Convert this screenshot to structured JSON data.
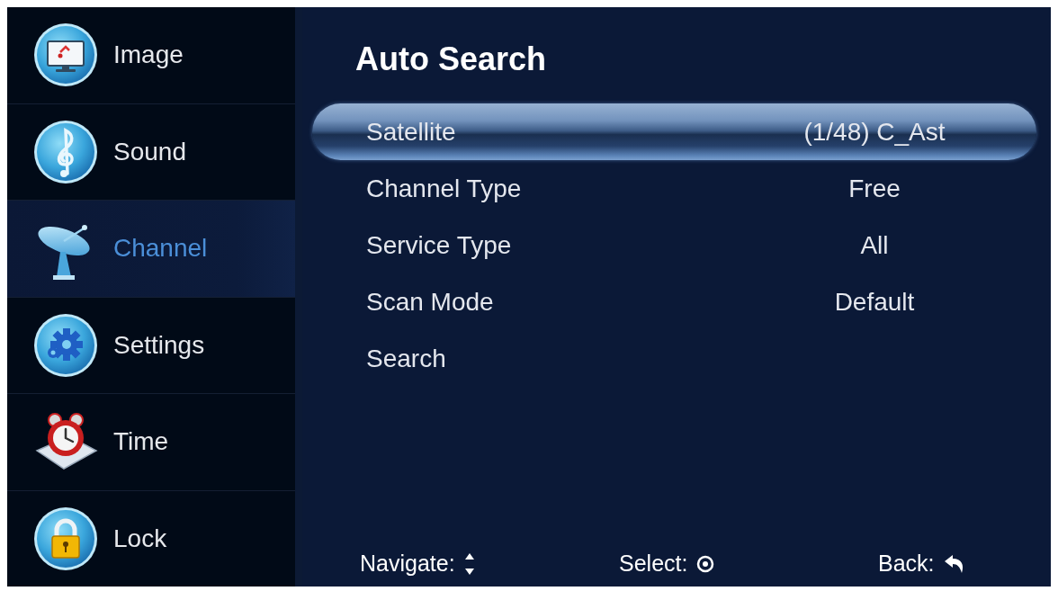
{
  "sidebar": {
    "items": [
      {
        "label": "Image",
        "selected": false
      },
      {
        "label": "Sound",
        "selected": false
      },
      {
        "label": "Channel",
        "selected": true
      },
      {
        "label": "Settings",
        "selected": false
      },
      {
        "label": "Time",
        "selected": false
      },
      {
        "label": "Lock",
        "selected": false
      }
    ]
  },
  "panel": {
    "title": "Auto Search",
    "rows": [
      {
        "label": "Satellite",
        "value": "(1/48) C_Ast",
        "selected": true
      },
      {
        "label": "Channel Type",
        "value": "Free",
        "selected": false
      },
      {
        "label": "Service Type",
        "value": "All",
        "selected": false
      },
      {
        "label": "Scan Mode",
        "value": "Default",
        "selected": false
      },
      {
        "label": "Search",
        "selected": false
      }
    ]
  },
  "footer": {
    "hints": [
      {
        "label": "Navigate:"
      },
      {
        "label": "Select:"
      },
      {
        "label": "Back:"
      }
    ]
  }
}
